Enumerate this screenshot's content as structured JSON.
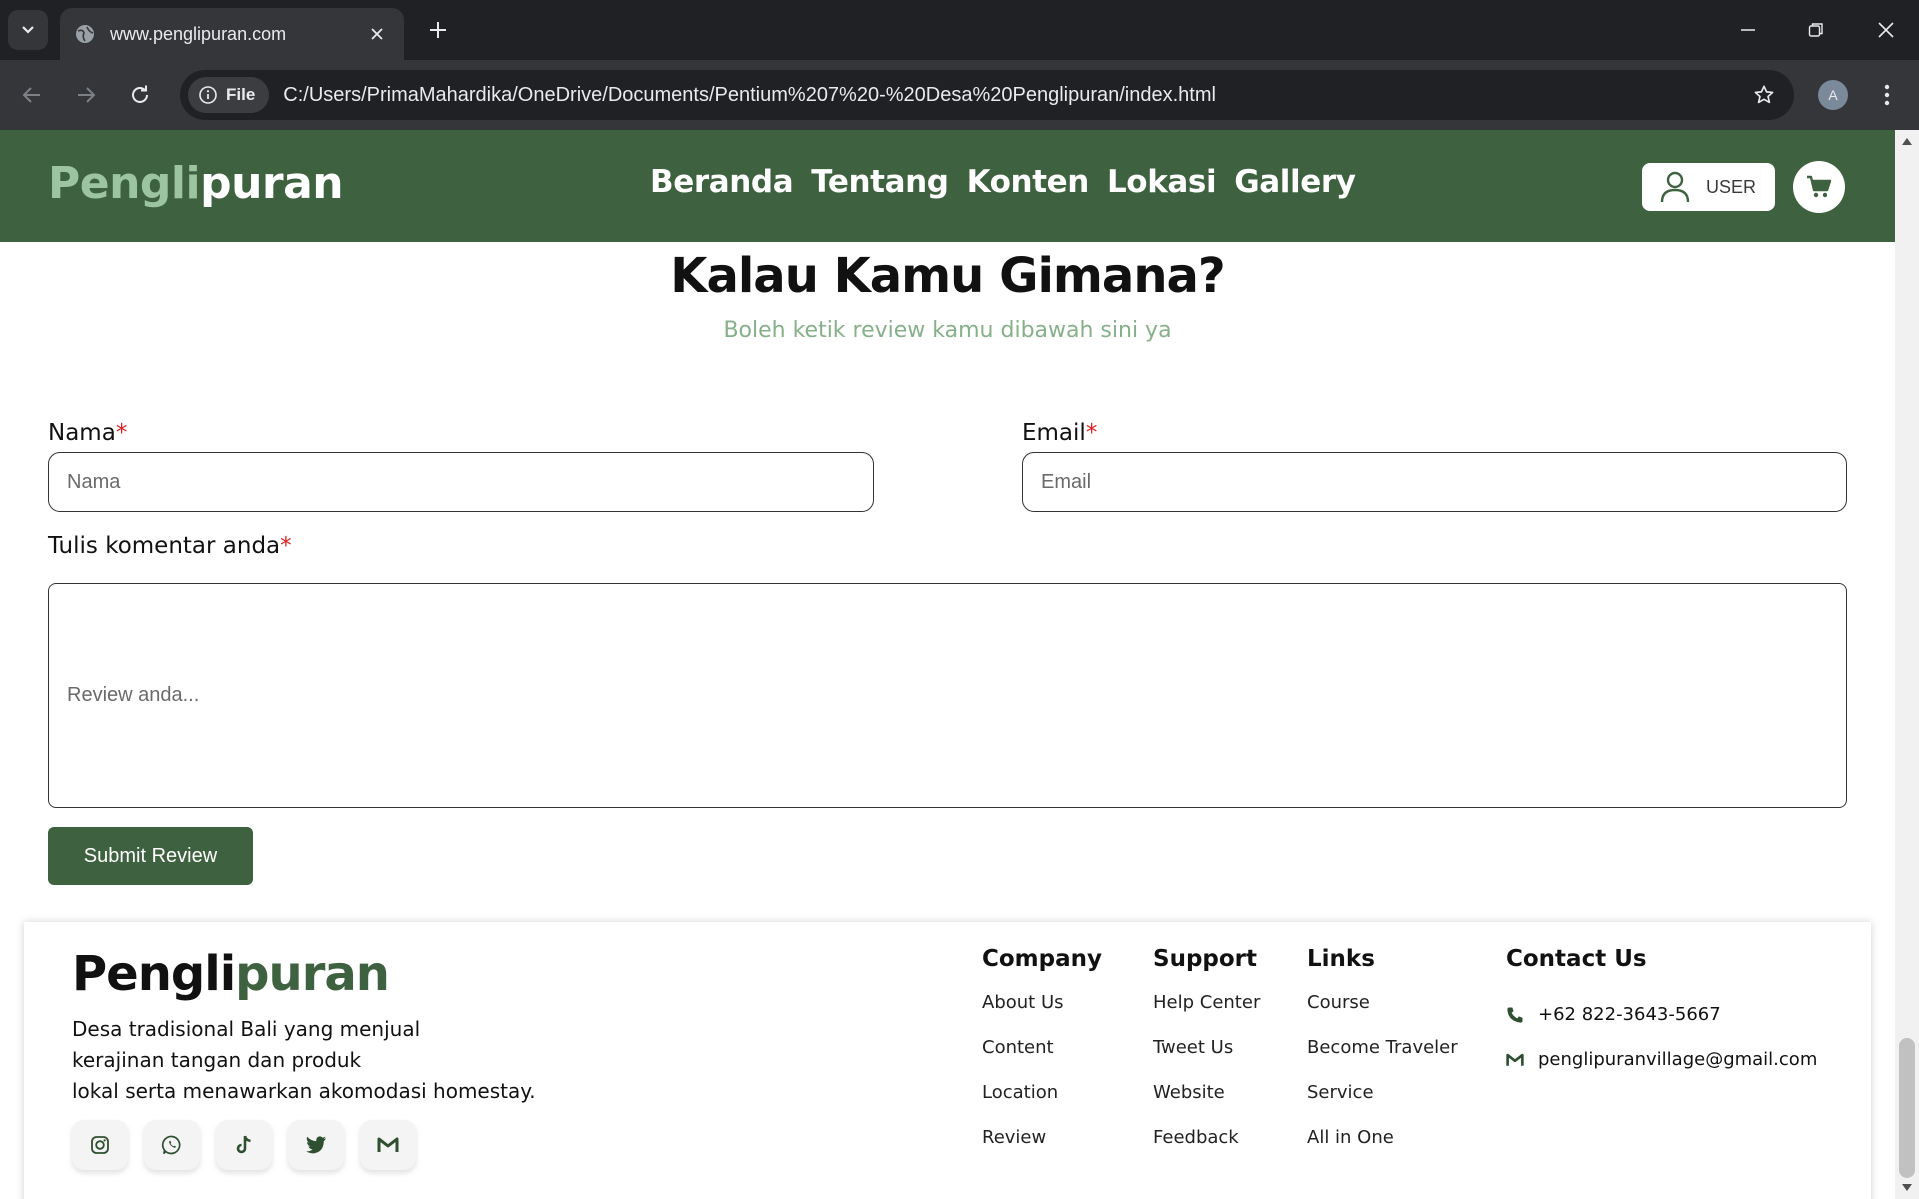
{
  "browser": {
    "tab_title": "www.penglipuran.com",
    "chip_label": "File",
    "url": "C:/Users/PrimaMahardika/OneDrive/Documents/Pentium%207%20-%20Desa%20Penglipuran/index.html",
    "profile_initial": "A"
  },
  "header": {
    "logo_part1": "Pengli",
    "logo_part2": "puran",
    "nav": [
      "Beranda",
      "Tentang",
      "Konten",
      "Lokasi",
      "Gallery"
    ],
    "user_label": "USER"
  },
  "review": {
    "title": "Kalau Kamu Gimana?",
    "subtitle": "Boleh ketik review kamu dibawah sini ya",
    "name_label": "Nama",
    "name_placeholder": "Nama",
    "email_label": "Email",
    "email_placeholder": "Email",
    "comment_label": "Tulis komentar anda",
    "comment_placeholder": "Review anda...",
    "required_mark": "*",
    "submit_label": "Submit Review"
  },
  "footer": {
    "logo_part1": "Pengli",
    "logo_part2": "puran",
    "description": [
      "Desa tradisional Bali yang menjual",
      "kerajinan tangan dan produk",
      "lokal serta menawarkan akomodasi homestay."
    ],
    "company": {
      "title": "Company",
      "links": [
        "About Us",
        "Content",
        "Location",
        "Review"
      ]
    },
    "support": {
      "title": "Support",
      "links": [
        "Help Center",
        "Tweet Us",
        "Website",
        "Feedback"
      ]
    },
    "links": {
      "title": "Links",
      "links": [
        "Course",
        "Become Traveler",
        "Service",
        "All in One"
      ]
    },
    "contact": {
      "title": "Contact Us",
      "phone": "+62 822-3643-5667",
      "email": "penglipuranvillage@gmail.com"
    },
    "socials": [
      "instagram-icon",
      "whatsapp-icon",
      "tiktok-icon",
      "twitter-icon",
      "gmail-icon"
    ]
  },
  "colors": {
    "brand_green": "#3e6140",
    "light_green": "#9cc49e",
    "required_red": "#e02020"
  }
}
